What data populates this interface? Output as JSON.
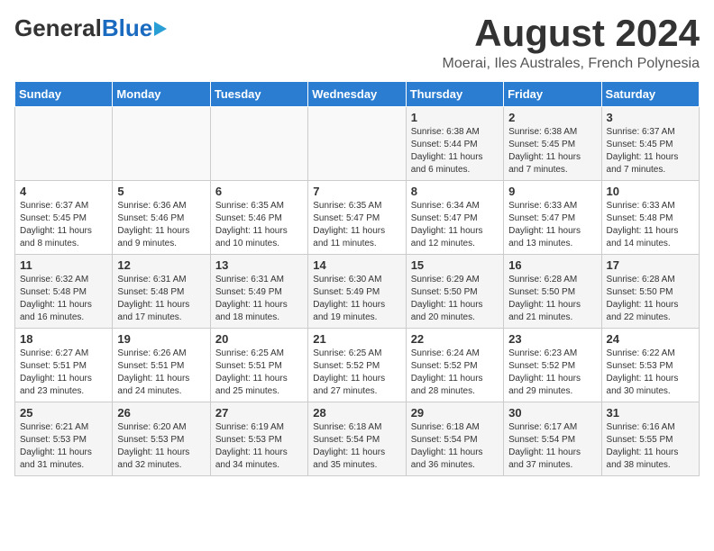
{
  "header": {
    "logo_general": "General",
    "logo_blue": "Blue",
    "month_title": "August 2024",
    "location": "Moerai, Iles Australes, French Polynesia"
  },
  "days_of_week": [
    "Sunday",
    "Monday",
    "Tuesday",
    "Wednesday",
    "Thursday",
    "Friday",
    "Saturday"
  ],
  "weeks": [
    [
      {
        "day": "",
        "sunrise": "",
        "sunset": "",
        "daylight": ""
      },
      {
        "day": "",
        "sunrise": "",
        "sunset": "",
        "daylight": ""
      },
      {
        "day": "",
        "sunrise": "",
        "sunset": "",
        "daylight": ""
      },
      {
        "day": "",
        "sunrise": "",
        "sunset": "",
        "daylight": ""
      },
      {
        "day": "1",
        "sunrise": "Sunrise: 6:38 AM",
        "sunset": "Sunset: 5:44 PM",
        "daylight": "Daylight: 11 hours and 6 minutes."
      },
      {
        "day": "2",
        "sunrise": "Sunrise: 6:38 AM",
        "sunset": "Sunset: 5:45 PM",
        "daylight": "Daylight: 11 hours and 7 minutes."
      },
      {
        "day": "3",
        "sunrise": "Sunrise: 6:37 AM",
        "sunset": "Sunset: 5:45 PM",
        "daylight": "Daylight: 11 hours and 7 minutes."
      }
    ],
    [
      {
        "day": "4",
        "sunrise": "Sunrise: 6:37 AM",
        "sunset": "Sunset: 5:45 PM",
        "daylight": "Daylight: 11 hours and 8 minutes."
      },
      {
        "day": "5",
        "sunrise": "Sunrise: 6:36 AM",
        "sunset": "Sunset: 5:46 PM",
        "daylight": "Daylight: 11 hours and 9 minutes."
      },
      {
        "day": "6",
        "sunrise": "Sunrise: 6:35 AM",
        "sunset": "Sunset: 5:46 PM",
        "daylight": "Daylight: 11 hours and 10 minutes."
      },
      {
        "day": "7",
        "sunrise": "Sunrise: 6:35 AM",
        "sunset": "Sunset: 5:47 PM",
        "daylight": "Daylight: 11 hours and 11 minutes."
      },
      {
        "day": "8",
        "sunrise": "Sunrise: 6:34 AM",
        "sunset": "Sunset: 5:47 PM",
        "daylight": "Daylight: 11 hours and 12 minutes."
      },
      {
        "day": "9",
        "sunrise": "Sunrise: 6:33 AM",
        "sunset": "Sunset: 5:47 PM",
        "daylight": "Daylight: 11 hours and 13 minutes."
      },
      {
        "day": "10",
        "sunrise": "Sunrise: 6:33 AM",
        "sunset": "Sunset: 5:48 PM",
        "daylight": "Daylight: 11 hours and 14 minutes."
      }
    ],
    [
      {
        "day": "11",
        "sunrise": "Sunrise: 6:32 AM",
        "sunset": "Sunset: 5:48 PM",
        "daylight": "Daylight: 11 hours and 16 minutes."
      },
      {
        "day": "12",
        "sunrise": "Sunrise: 6:31 AM",
        "sunset": "Sunset: 5:48 PM",
        "daylight": "Daylight: 11 hours and 17 minutes."
      },
      {
        "day": "13",
        "sunrise": "Sunrise: 6:31 AM",
        "sunset": "Sunset: 5:49 PM",
        "daylight": "Daylight: 11 hours and 18 minutes."
      },
      {
        "day": "14",
        "sunrise": "Sunrise: 6:30 AM",
        "sunset": "Sunset: 5:49 PM",
        "daylight": "Daylight: 11 hours and 19 minutes."
      },
      {
        "day": "15",
        "sunrise": "Sunrise: 6:29 AM",
        "sunset": "Sunset: 5:50 PM",
        "daylight": "Daylight: 11 hours and 20 minutes."
      },
      {
        "day": "16",
        "sunrise": "Sunrise: 6:28 AM",
        "sunset": "Sunset: 5:50 PM",
        "daylight": "Daylight: 11 hours and 21 minutes."
      },
      {
        "day": "17",
        "sunrise": "Sunrise: 6:28 AM",
        "sunset": "Sunset: 5:50 PM",
        "daylight": "Daylight: 11 hours and 22 minutes."
      }
    ],
    [
      {
        "day": "18",
        "sunrise": "Sunrise: 6:27 AM",
        "sunset": "Sunset: 5:51 PM",
        "daylight": "Daylight: 11 hours and 23 minutes."
      },
      {
        "day": "19",
        "sunrise": "Sunrise: 6:26 AM",
        "sunset": "Sunset: 5:51 PM",
        "daylight": "Daylight: 11 hours and 24 minutes."
      },
      {
        "day": "20",
        "sunrise": "Sunrise: 6:25 AM",
        "sunset": "Sunset: 5:51 PM",
        "daylight": "Daylight: 11 hours and 25 minutes."
      },
      {
        "day": "21",
        "sunrise": "Sunrise: 6:25 AM",
        "sunset": "Sunset: 5:52 PM",
        "daylight": "Daylight: 11 hours and 27 minutes."
      },
      {
        "day": "22",
        "sunrise": "Sunrise: 6:24 AM",
        "sunset": "Sunset: 5:52 PM",
        "daylight": "Daylight: 11 hours and 28 minutes."
      },
      {
        "day": "23",
        "sunrise": "Sunrise: 6:23 AM",
        "sunset": "Sunset: 5:52 PM",
        "daylight": "Daylight: 11 hours and 29 minutes."
      },
      {
        "day": "24",
        "sunrise": "Sunrise: 6:22 AM",
        "sunset": "Sunset: 5:53 PM",
        "daylight": "Daylight: 11 hours and 30 minutes."
      }
    ],
    [
      {
        "day": "25",
        "sunrise": "Sunrise: 6:21 AM",
        "sunset": "Sunset: 5:53 PM",
        "daylight": "Daylight: 11 hours and 31 minutes."
      },
      {
        "day": "26",
        "sunrise": "Sunrise: 6:20 AM",
        "sunset": "Sunset: 5:53 PM",
        "daylight": "Daylight: 11 hours and 32 minutes."
      },
      {
        "day": "27",
        "sunrise": "Sunrise: 6:19 AM",
        "sunset": "Sunset: 5:53 PM",
        "daylight": "Daylight: 11 hours and 34 minutes."
      },
      {
        "day": "28",
        "sunrise": "Sunrise: 6:18 AM",
        "sunset": "Sunset: 5:54 PM",
        "daylight": "Daylight: 11 hours and 35 minutes."
      },
      {
        "day": "29",
        "sunrise": "Sunrise: 6:18 AM",
        "sunset": "Sunset: 5:54 PM",
        "daylight": "Daylight: 11 hours and 36 minutes."
      },
      {
        "day": "30",
        "sunrise": "Sunrise: 6:17 AM",
        "sunset": "Sunset: 5:54 PM",
        "daylight": "Daylight: 11 hours and 37 minutes."
      },
      {
        "day": "31",
        "sunrise": "Sunrise: 6:16 AM",
        "sunset": "Sunset: 5:55 PM",
        "daylight": "Daylight: 11 hours and 38 minutes."
      }
    ]
  ]
}
